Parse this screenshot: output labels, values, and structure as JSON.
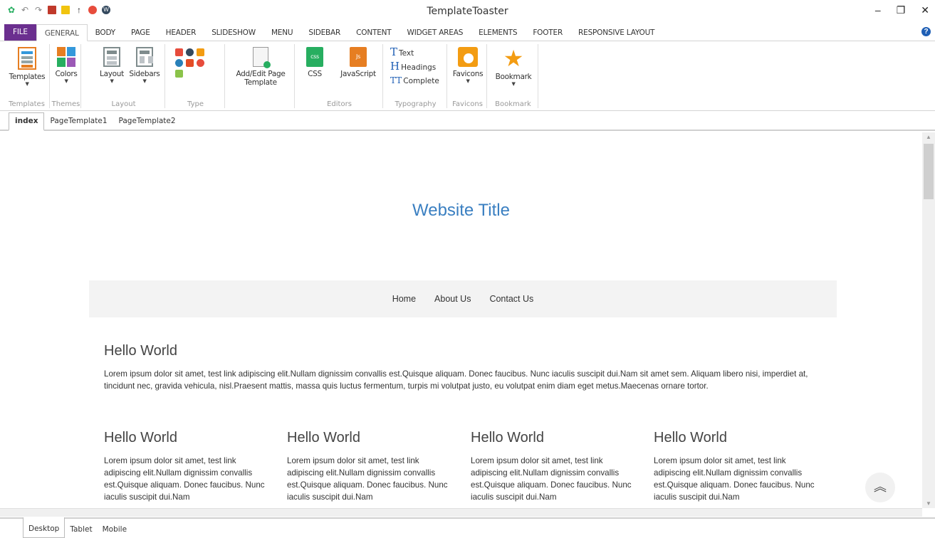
{
  "app": {
    "title": "TemplateToaster"
  },
  "ribbon_tabs": [
    "FILE",
    "GENERAL",
    "BODY",
    "PAGE",
    "HEADER",
    "SLIDESHOW",
    "MENU",
    "SIDEBAR",
    "CONTENT",
    "WIDGET AREAS",
    "ELEMENTS",
    "FOOTER",
    "RESPONSIVE LAYOUT"
  ],
  "ribbon": {
    "templates": {
      "button": "Templates",
      "group": "Templates"
    },
    "themes": {
      "button": "Colors",
      "group": "Themes"
    },
    "layout": {
      "layout_btn": "Layout",
      "sidebars_btn": "Sidebars",
      "group": "Layout"
    },
    "type": {
      "group": "Type"
    },
    "page": {
      "button_line1": "Add/Edit Page",
      "button_line2": "Template"
    },
    "editors": {
      "css": "CSS",
      "js": "JavaScript",
      "group": "Editors",
      "css_icon_text": "css",
      "js_icon_text": "Js"
    },
    "typography": {
      "text": "Text",
      "headings": "Headings",
      "complete": "Complete",
      "group": "Typography"
    },
    "favicons": {
      "button": "Favicons",
      "group": "Favicons"
    },
    "bookmark": {
      "button": "Bookmark",
      "group": "Bookmark"
    }
  },
  "page_tabs": [
    "index",
    "PageTemplate1",
    "PageTemplate2"
  ],
  "site": {
    "title": "Website Title",
    "nav": [
      "Home",
      "About Us",
      "Contact Us"
    ],
    "main_heading": "Hello World",
    "main_text": "Lorem ipsum dolor sit amet, test link adipiscing elit.Nullam dignissim convallis est.Quisque aliquam. Donec faucibus. Nunc iaculis suscipit dui.Nam sit amet sem. Aliquam libero nisi, imperdiet at, tincidunt nec, gravida vehicula, nisl.Praesent mattis, massa quis luctus fermentum, turpis mi volutpat justo, eu volutpat enim diam eget metus.Maecenas ornare tortor.",
    "columns": [
      {
        "heading": "Hello World",
        "text": "Lorem ipsum dolor sit amet, test link adipiscing elit.Nullam dignissim convallis est.Quisque aliquam. Donec faucibus. Nunc iaculis suscipit dui.Nam"
      },
      {
        "heading": "Hello World",
        "text": "Lorem ipsum dolor sit amet, test link adipiscing elit.Nullam dignissim convallis est.Quisque aliquam. Donec faucibus. Nunc iaculis suscipit dui.Nam"
      },
      {
        "heading": "Hello World",
        "text": "Lorem ipsum dolor sit amet, test link adipiscing elit.Nullam dignissim convallis est.Quisque aliquam. Donec faucibus. Nunc iaculis suscipit dui.Nam"
      },
      {
        "heading": "Hello World",
        "text": "Lorem ipsum dolor sit amet, test link adipiscing elit.Nullam dignissim convallis est.Quisque aliquam. Donec faucibus. Nunc iaculis suscipit dui.Nam"
      }
    ]
  },
  "device_tabs": [
    "Desktop",
    "Tablet",
    "Mobile"
  ],
  "colors": {
    "file_tab": "#6b2f8f",
    "title_link": "#3a7fc1",
    "accent_orange": "#f39c12"
  }
}
